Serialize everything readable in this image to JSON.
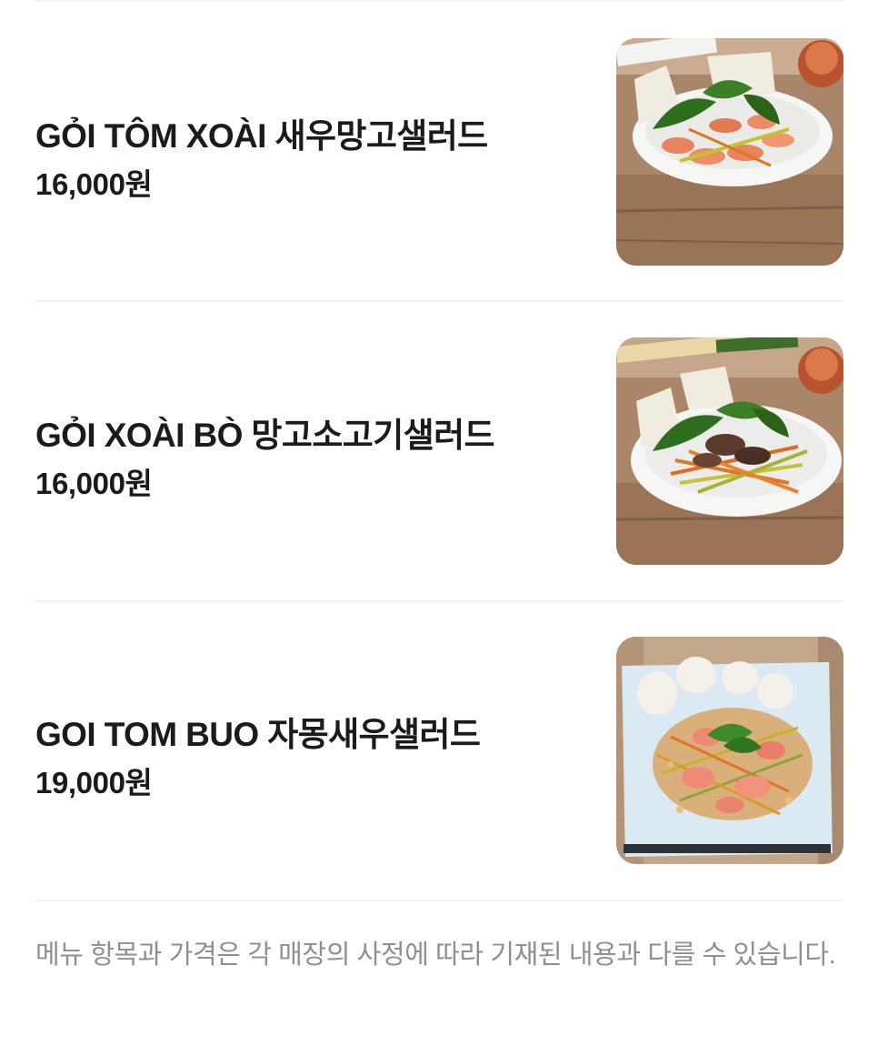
{
  "menu": {
    "items": [
      {
        "name": "GỎI TÔM XOÀI 새우망고샐러드",
        "price": "16,000원",
        "image": "shrimp-mango-salad-photo"
      },
      {
        "name": "GỎI XOÀI BÒ 망고소고기샐러드",
        "price": "16,000원",
        "image": "beef-mango-salad-photo"
      },
      {
        "name": "GOI TOM BUO 자몽새우샐러드",
        "price": "19,000원",
        "image": "grapefruit-shrimp-salad-photo"
      }
    ]
  },
  "notice": "메뉴 항목과 가격은 각 매장의 사정에 따라 기재된 내용과 다를 수 있습니다."
}
